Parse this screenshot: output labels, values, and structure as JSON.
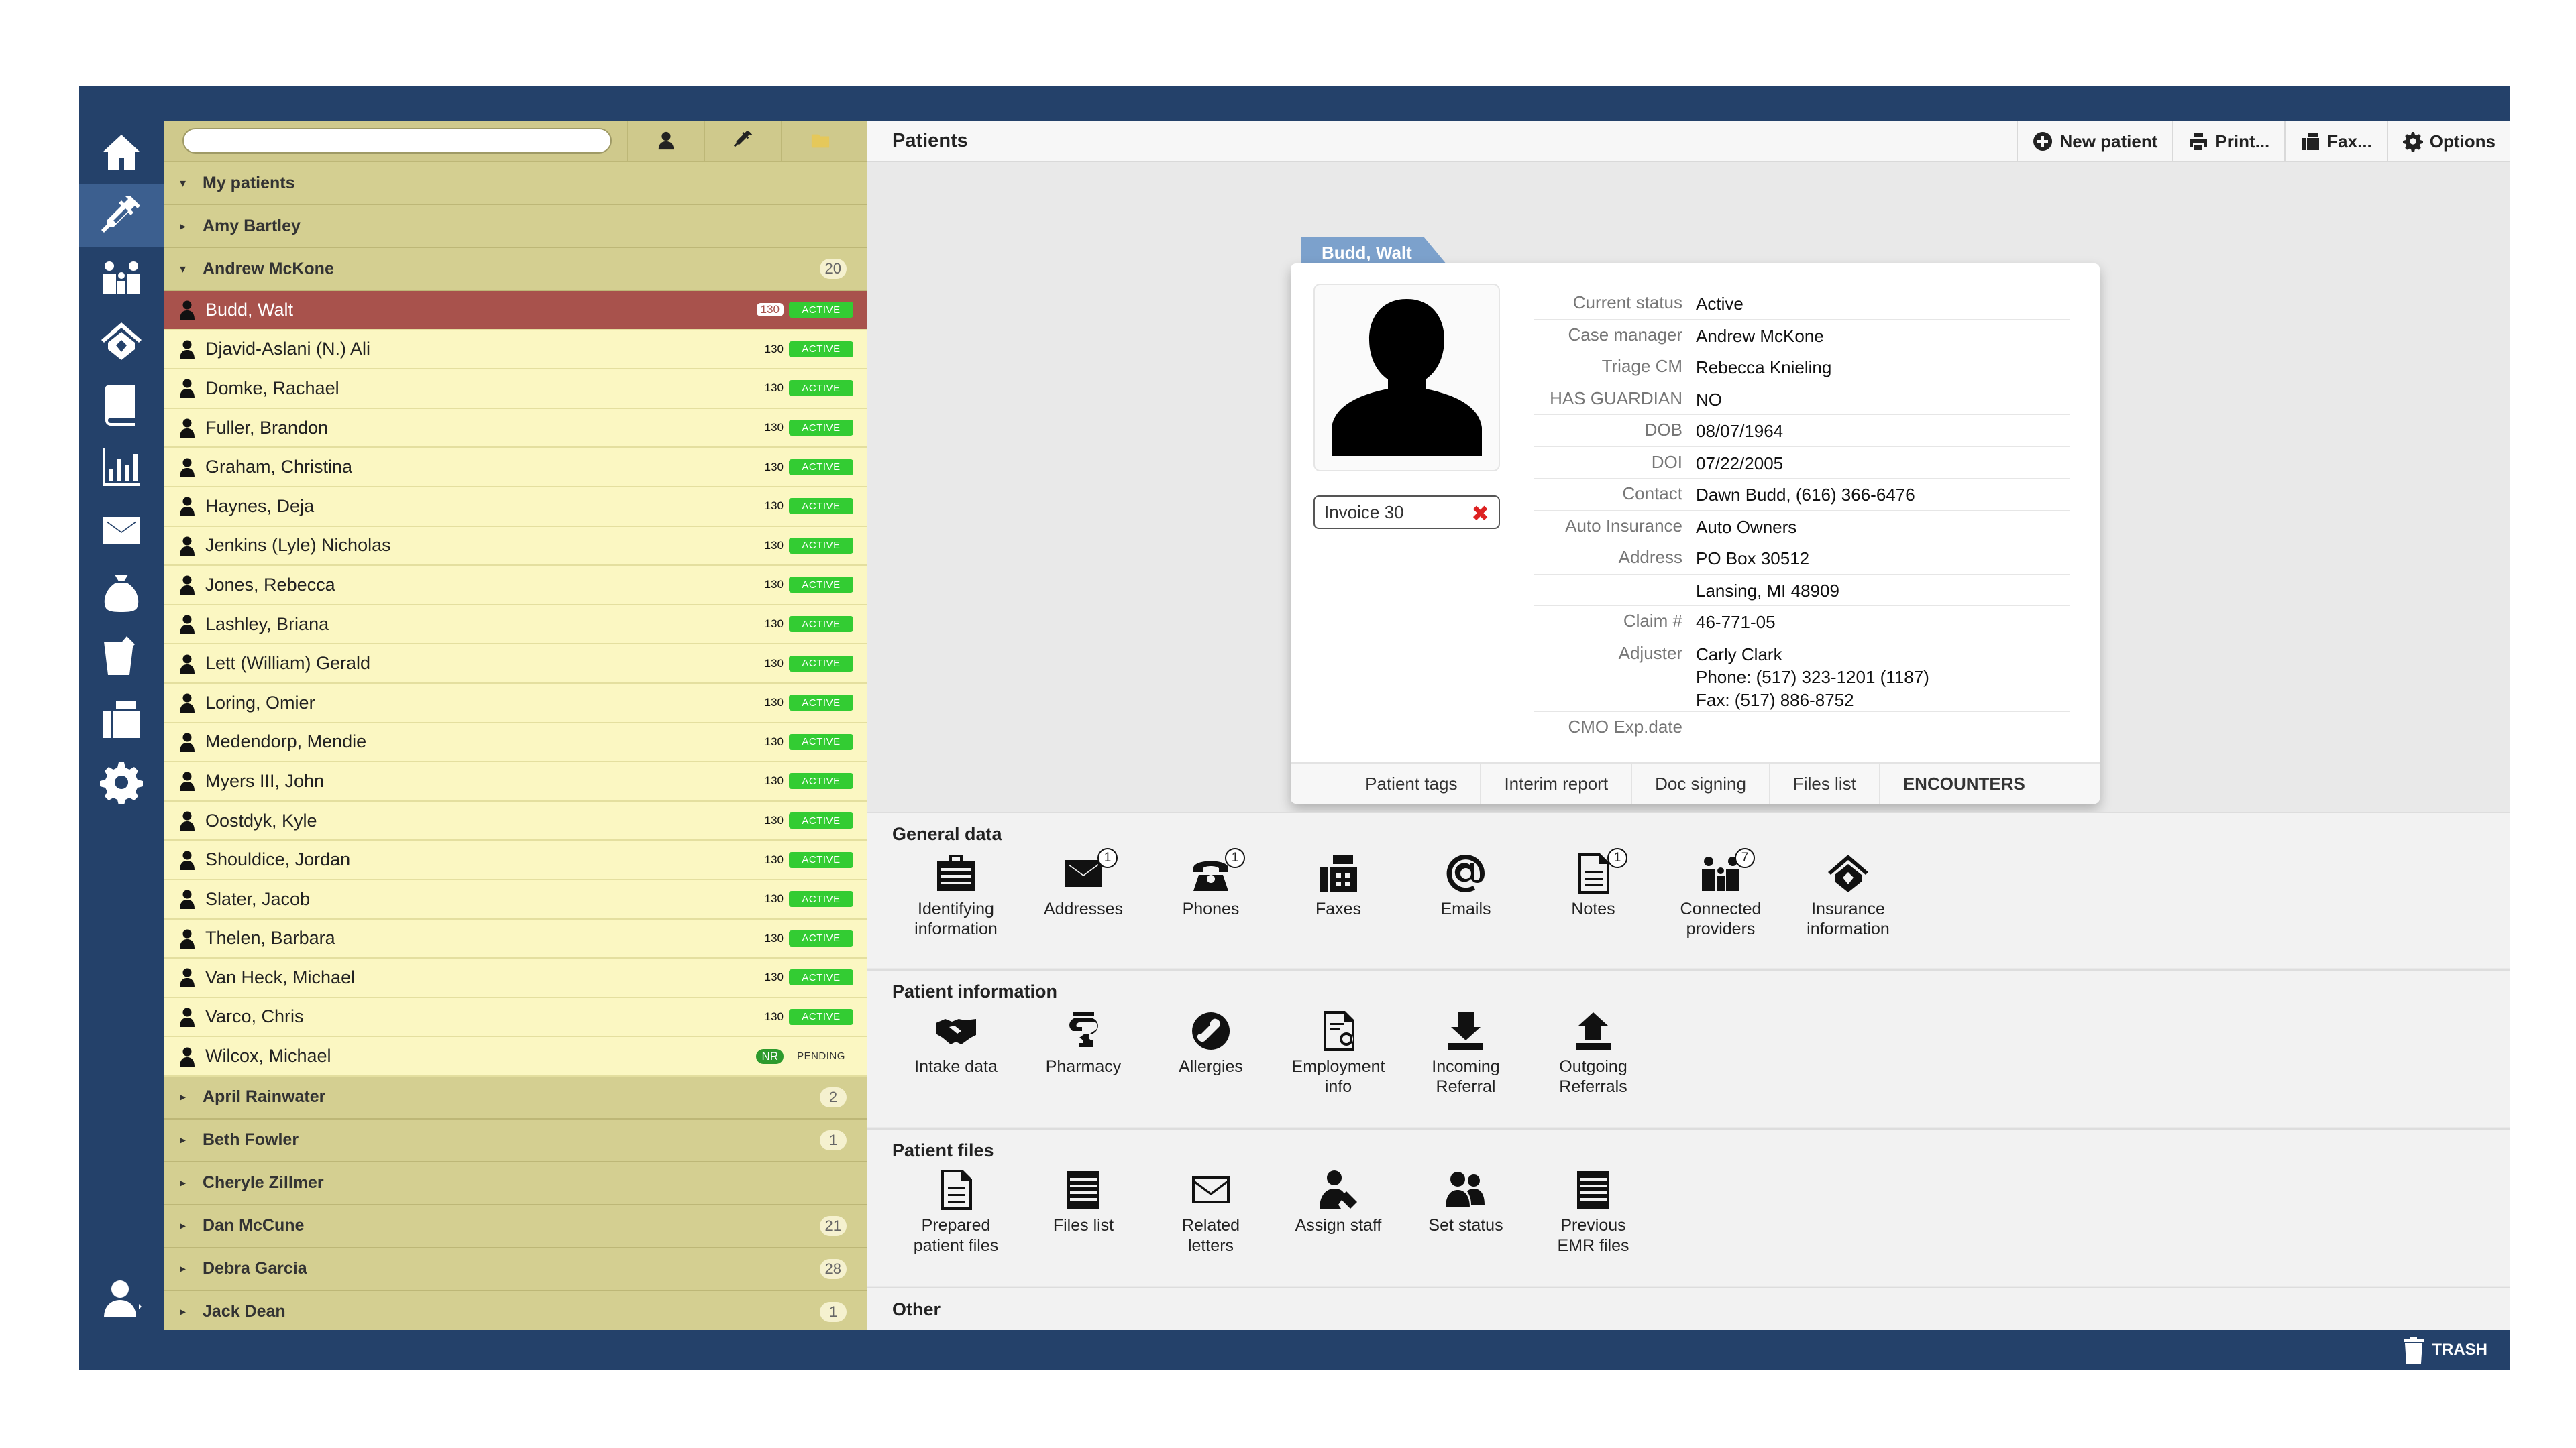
{
  "list": {
    "search_placeholder": "",
    "groups_top": [
      {
        "name": "My patients",
        "count": "",
        "caret": "▾"
      },
      {
        "name": "Amy Bartley",
        "count": "",
        "caret": "▸"
      },
      {
        "name": "Andrew McKone",
        "count": "20",
        "caret": "▾"
      }
    ],
    "patients": [
      {
        "name": "Budd, Walt",
        "code": "130",
        "status": "ACTIVE"
      },
      {
        "name": "Djavid-Aslani (N.) Ali",
        "code": "130",
        "status": "ACTIVE"
      },
      {
        "name": "Domke, Rachael",
        "code": "130",
        "status": "ACTIVE"
      },
      {
        "name": "Fuller, Brandon",
        "code": "130",
        "status": "ACTIVE"
      },
      {
        "name": "Graham, Christina",
        "code": "130",
        "status": "ACTIVE"
      },
      {
        "name": "Haynes, Deja",
        "code": "130",
        "status": "ACTIVE"
      },
      {
        "name": "Jenkins (Lyle) Nicholas",
        "code": "130",
        "status": "ACTIVE"
      },
      {
        "name": "Jones, Rebecca",
        "code": "130",
        "status": "ACTIVE"
      },
      {
        "name": "Lashley, Briana",
        "code": "130",
        "status": "ACTIVE"
      },
      {
        "name": "Lett (William) Gerald",
        "code": "130",
        "status": "ACTIVE"
      },
      {
        "name": "Loring, Omier",
        "code": "130",
        "status": "ACTIVE"
      },
      {
        "name": "Medendorp, Mendie",
        "code": "130",
        "status": "ACTIVE"
      },
      {
        "name": "Myers III, John",
        "code": "130",
        "status": "ACTIVE"
      },
      {
        "name": "Oostdyk, Kyle",
        "code": "130",
        "status": "ACTIVE"
      },
      {
        "name": "Shouldice, Jordan",
        "code": "130",
        "status": "ACTIVE"
      },
      {
        "name": "Slater, Jacob",
        "code": "130",
        "status": "ACTIVE"
      },
      {
        "name": "Thelen, Barbara",
        "code": "130",
        "status": "ACTIVE"
      },
      {
        "name": "Van Heck, Michael",
        "code": "130",
        "status": "ACTIVE"
      },
      {
        "name": "Varco, Chris",
        "code": "130",
        "status": "ACTIVE"
      },
      {
        "name": "Wilcox, Michael",
        "code": "NR",
        "status": "PENDING"
      }
    ],
    "groups_bottom": [
      {
        "name": "April Rainwater",
        "count": "2",
        "caret": "▸"
      },
      {
        "name": "Beth Fowler",
        "count": "1",
        "caret": "▸"
      },
      {
        "name": "Cheryle Zillmer",
        "count": "",
        "caret": "▸"
      },
      {
        "name": "Dan McCune",
        "count": "21",
        "caret": "▸"
      },
      {
        "name": "Debra Garcia",
        "count": "28",
        "caret": "▸"
      },
      {
        "name": "Jack Dean",
        "count": "1",
        "caret": "▸"
      }
    ]
  },
  "header": {
    "title": "Patients",
    "new_patient": "New patient",
    "print": "Print...",
    "fax": "Fax...",
    "options": "Options"
  },
  "card": {
    "tab_name": "Budd, Walt",
    "invoice": "Invoice 30",
    "details": [
      {
        "label": "Current status",
        "value": "Active"
      },
      {
        "label": "Case manager",
        "value": "Andrew McKone"
      },
      {
        "label": "Triage CM",
        "value": "Rebecca Knieling"
      },
      {
        "label": "HAS GUARDIAN",
        "value": "NO"
      },
      {
        "label": "DOB",
        "value": "08/07/1964"
      },
      {
        "label": "DOI",
        "value": "07/22/2005"
      },
      {
        "label": "Contact",
        "value": "Dawn Budd, (616) 366-6476"
      },
      {
        "label": "Auto Insurance",
        "value": "Auto Owners"
      },
      {
        "label": "Address",
        "value": "PO Box 30512"
      },
      {
        "label": "",
        "value": "Lansing, MI 48909"
      },
      {
        "label": "Claim #",
        "value": "46-771-05"
      },
      {
        "label": "Adjuster",
        "value": "Carly Clark\nPhone: (517) 323-1201 (1187)\nFax: (517) 886-8752"
      },
      {
        "label": "CMO Exp.date",
        "value": ""
      }
    ],
    "tabs": [
      "Patient tags",
      "Interim report",
      "Doc signing",
      "Files list",
      "ENCOUNTERS"
    ]
  },
  "sections": {
    "general": {
      "title": "General data",
      "tiles": [
        {
          "label": "Identifying\ninformation",
          "icon": "id-card-icon",
          "badge": ""
        },
        {
          "label": "Addresses",
          "icon": "envelope-icon",
          "badge": "1"
        },
        {
          "label": "Phones",
          "icon": "phone-icon",
          "badge": "1"
        },
        {
          "label": "Faxes",
          "icon": "fax-icon",
          "badge": ""
        },
        {
          "label": "Emails",
          "icon": "at-icon",
          "badge": ""
        },
        {
          "label": "Notes",
          "icon": "note-icon",
          "badge": "1"
        },
        {
          "label": "Connected\nproviders",
          "icon": "providers-icon",
          "badge": "7"
        },
        {
          "label": "Insurance\ninformation",
          "icon": "insurance-icon",
          "badge": ""
        }
      ]
    },
    "patient_info": {
      "title": "Patient information",
      "tiles": [
        {
          "label": "Intake data",
          "icon": "handshake-icon"
        },
        {
          "label": "Pharmacy",
          "icon": "pharmacy-icon"
        },
        {
          "label": "Allergies",
          "icon": "allergies-icon"
        },
        {
          "label": "Employment\ninfo",
          "icon": "employment-icon"
        },
        {
          "label": "Incoming\nReferral",
          "icon": "incoming-referral-icon"
        },
        {
          "label": "Outgoing\nReferrals",
          "icon": "outgoing-referral-icon"
        }
      ]
    },
    "patient_files": {
      "title": "Patient files",
      "tiles": [
        {
          "label": "Prepared\npatient files",
          "icon": "document-icon"
        },
        {
          "label": "Files list",
          "icon": "files-icon"
        },
        {
          "label": "Related\nletters",
          "icon": "letters-icon"
        },
        {
          "label": "Assign staff",
          "icon": "assign-staff-icon"
        },
        {
          "label": "Set status",
          "icon": "status-icon"
        },
        {
          "label": "Previous\nEMR files",
          "icon": "emr-files-icon"
        }
      ]
    },
    "other": {
      "title": "Other"
    }
  },
  "bottom": {
    "trash": "TRASH"
  },
  "colors": {
    "frame": "#24416a",
    "list_bg": "#d4cf91",
    "row_bg": "#fbf7c2",
    "selected_row": "#a8524c",
    "active_badge": "#33cc33",
    "card_tab": "#7ca1cc"
  }
}
